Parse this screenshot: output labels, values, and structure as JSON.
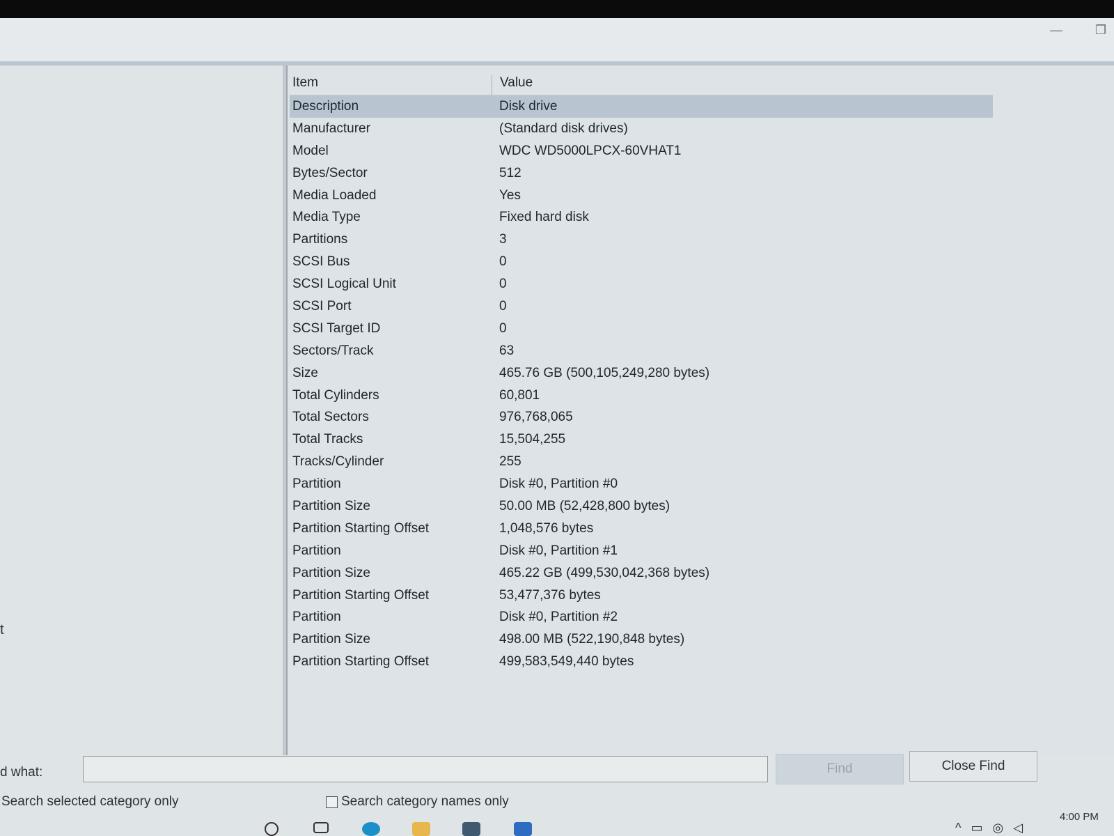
{
  "window": {
    "minimize_glyph": "—",
    "maximize_glyph": "❐"
  },
  "left_pane": {
    "partial_text": "t"
  },
  "table": {
    "headers": [
      "Item",
      "Value"
    ],
    "rows": [
      {
        "item": "Description",
        "value": "Disk drive"
      },
      {
        "item": "Manufacturer",
        "value": "(Standard disk drives)"
      },
      {
        "item": "Model",
        "value": "WDC WD5000LPCX-60VHAT1"
      },
      {
        "item": "Bytes/Sector",
        "value": "512"
      },
      {
        "item": "Media Loaded",
        "value": "Yes"
      },
      {
        "item": "Media Type",
        "value": "Fixed hard disk"
      },
      {
        "item": "Partitions",
        "value": "3"
      },
      {
        "item": "SCSI Bus",
        "value": "0"
      },
      {
        "item": "SCSI Logical Unit",
        "value": "0"
      },
      {
        "item": "SCSI Port",
        "value": "0"
      },
      {
        "item": "SCSI Target ID",
        "value": "0"
      },
      {
        "item": "Sectors/Track",
        "value": "63"
      },
      {
        "item": "Size",
        "value": "465.76 GB (500,105,249,280 bytes)"
      },
      {
        "item": "Total Cylinders",
        "value": "60,801"
      },
      {
        "item": "Total Sectors",
        "value": "976,768,065"
      },
      {
        "item": "Total Tracks",
        "value": "15,504,255"
      },
      {
        "item": "Tracks/Cylinder",
        "value": "255"
      },
      {
        "item": "Partition",
        "value": "Disk #0, Partition #0"
      },
      {
        "item": "Partition Size",
        "value": "50.00 MB (52,428,800 bytes)"
      },
      {
        "item": "Partition Starting Offset",
        "value": "1,048,576 bytes"
      },
      {
        "item": "Partition",
        "value": "Disk #0, Partition #1"
      },
      {
        "item": "Partition Size",
        "value": "465.22 GB (499,530,042,368 bytes)"
      },
      {
        "item": "Partition Starting Offset",
        "value": "53,477,376 bytes"
      },
      {
        "item": "Partition",
        "value": "Disk #0, Partition #2"
      },
      {
        "item": "Partition Size",
        "value": "498.00 MB (522,190,848 bytes)"
      },
      {
        "item": "Partition Starting Offset",
        "value": "499,583,549,440 bytes"
      }
    ]
  },
  "find": {
    "label": "d what:",
    "input_value": "",
    "find_button": "Find",
    "close_find_button": "Close Find",
    "search_selected_label": "Search selected category only",
    "search_names_label": "Search category names only"
  },
  "tray": {
    "chevron": "^",
    "clock": "4:00 PM"
  },
  "colors": {
    "selected_row": "#b8c5d1",
    "background": "#dde3e6"
  }
}
